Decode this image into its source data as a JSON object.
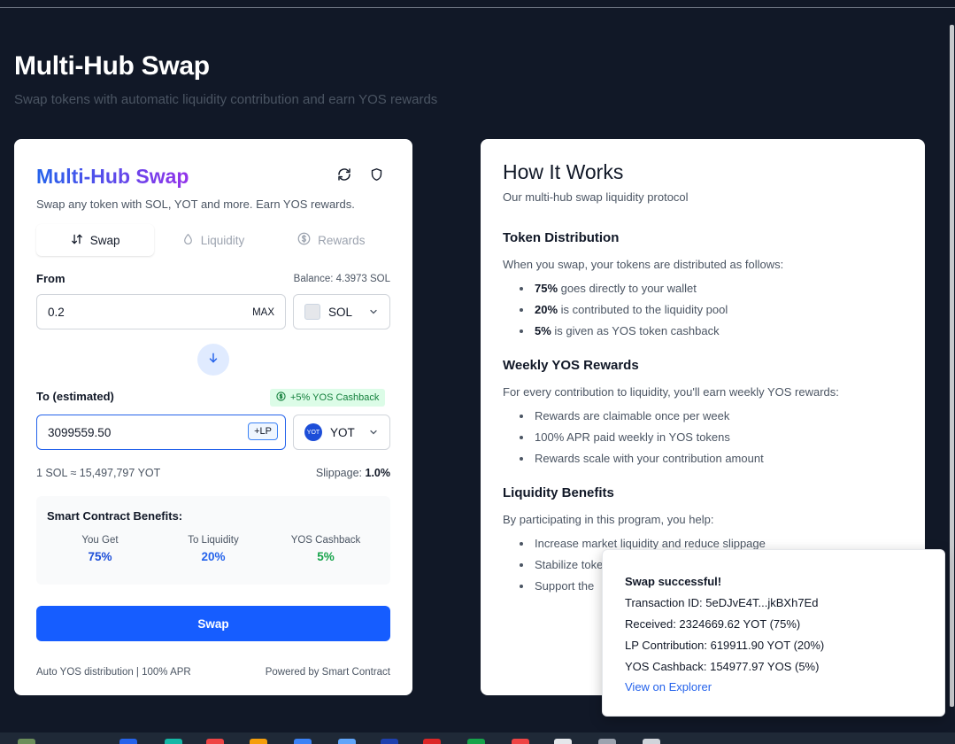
{
  "page": {
    "title": "Multi-Hub Swap",
    "subtitle": "Swap tokens with automatic liquidity contribution and earn YOS rewards"
  },
  "swap_card": {
    "title": "Multi-Hub Swap",
    "subtitle": "Swap any token with SOL, YOT and more. Earn YOS rewards.",
    "tabs": [
      {
        "label": "Swap",
        "icon": "swap-arrows-icon",
        "active": true
      },
      {
        "label": "Liquidity",
        "icon": "droplet-icon",
        "active": false
      },
      {
        "label": "Rewards",
        "icon": "dollar-circle-icon",
        "active": false
      }
    ],
    "from": {
      "label": "From",
      "balance": "Balance: 4.3973 SOL",
      "value": "0.2",
      "max_label": "MAX",
      "token": "SOL"
    },
    "to": {
      "label": "To (estimated)",
      "cashback_badge": "+5% YOS Cashback",
      "value": "3099559.50",
      "lp_label": "+LP",
      "token": "YOT",
      "token_icon_text": "YOT"
    },
    "rate": "1 SOL ≈ 15,497,797 YOT",
    "slippage_label": "Slippage:",
    "slippage_value": "1.0%",
    "benefits": {
      "title": "Smart Contract Benefits:",
      "items": [
        {
          "label": "You Get",
          "value": "75%",
          "color": "#1d4ed8"
        },
        {
          "label": "To Liquidity",
          "value": "20%",
          "color": "#2563eb"
        },
        {
          "label": "YOS Cashback",
          "value": "5%",
          "color": "#16a34a"
        }
      ]
    },
    "swap_button": "Swap",
    "footer_left": "Auto YOS distribution | 100% APR",
    "footer_right": "Powered by Smart Contract"
  },
  "how_it_works": {
    "title": "How It Works",
    "subtitle": "Our multi-hub swap liquidity protocol",
    "sections": [
      {
        "heading": "Token Distribution",
        "intro": "When you swap, your tokens are distributed as follows:",
        "bullets": [
          {
            "bold": "75%",
            "text": " goes directly to your wallet"
          },
          {
            "bold": "20%",
            "text": " is contributed to the liquidity pool"
          },
          {
            "bold": "5%",
            "text": " is given as YOS token cashback"
          }
        ]
      },
      {
        "heading": "Weekly YOS Rewards",
        "intro": "For every contribution to liquidity, you'll earn weekly YOS rewards:",
        "bullets": [
          {
            "bold": "",
            "text": "Rewards are claimable once per week"
          },
          {
            "bold": "",
            "text": "100% APR paid weekly in YOS tokens"
          },
          {
            "bold": "",
            "text": "Rewards scale with your contribution amount"
          }
        ]
      },
      {
        "heading": "Liquidity Benefits",
        "intro": "By participating in this program, you help:",
        "bullets": [
          {
            "bold": "",
            "text": "Increase market liquidity and reduce slippage"
          },
          {
            "bold": "",
            "text": "Stabilize toke"
          },
          {
            "bold": "",
            "text": "Support the"
          }
        ]
      }
    ]
  },
  "toast": {
    "title": "Swap successful!",
    "lines": [
      "Transaction ID: 5eDJvE4T...jkBXh7Ed",
      "Received: 2324669.62 YOT (75%)",
      "LP Contribution: 619911.90 YOT (20%)",
      "YOS Cashback: 154977.97 YOS (5%)"
    ],
    "link": "View on Explorer"
  }
}
